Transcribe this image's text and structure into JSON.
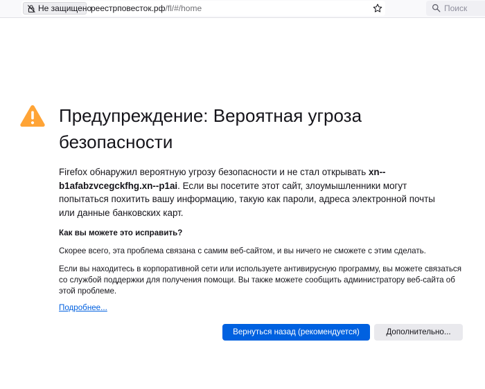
{
  "toolbar": {
    "security_label": "Не защищено",
    "url_domain": "реестрповесток.рф",
    "url_path": "/fl/#/home",
    "search_placeholder": "Поиск",
    "icons": [
      "insecure-lock-icon",
      "bookmark-star-icon",
      "search-icon"
    ]
  },
  "error_page": {
    "icon": "warning-icon",
    "title": "Предупреждение: Вероятная угроза безопасности",
    "intro_before": "Firefox обнаружил вероятную угрозу безопасности и не стал открывать ",
    "intro_host": "xn--b1afabzvcegckfhg.xn--p1ai",
    "intro_after": ". Если вы посетите этот сайт, злоумышленники могут попытаться похитить вашу информацию, такую как пароли, адреса электронной почты или данные банковских карт.",
    "fix_heading": "Как вы можете это исправить?",
    "fix_para1": "Скорее всего, эта проблема связана с самим веб-сайтом, и вы ничего не сможете с этим сделать.",
    "fix_para2": "Если вы находитесь в корпоративной сети или используете антивирусную программу, вы можете связаться со службой поддержки для получения помощи. Вы также можете сообщить администратору веб-сайта об этой проблеме.",
    "learn_more": "Подробнее...",
    "go_back_button": "Вернуться назад (рекомендуется)",
    "advanced_button": "Дополнительно..."
  },
  "colors": {
    "warning": "#ffa436",
    "primary_button": "#0061e0",
    "link": "#0060df",
    "secondary_button": "#e9e9ed"
  }
}
